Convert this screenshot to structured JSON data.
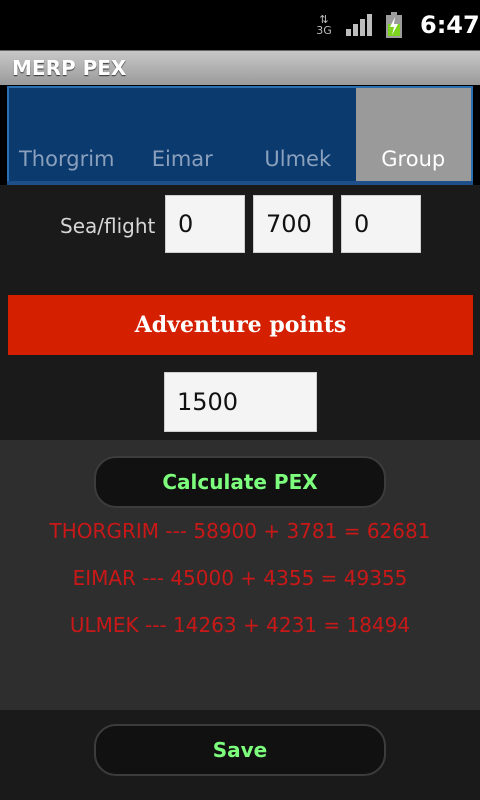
{
  "status_bar": {
    "data_icon": "3G data arrows icon",
    "network": "3G",
    "signal_icon": "signal-bars",
    "battery_icon": "battery-charging",
    "time": "6:47"
  },
  "app": {
    "title": "MERP PEX"
  },
  "tabs": [
    {
      "label": "Thorgrim",
      "selected": false
    },
    {
      "label": "Eimar",
      "selected": false
    },
    {
      "label": "Ulmek",
      "selected": false
    },
    {
      "label": "Group",
      "selected": true
    }
  ],
  "sea_flight": {
    "label": "Sea/flight",
    "values": [
      "0",
      "700",
      "0"
    ]
  },
  "adventure": {
    "header": "Adventure points",
    "value": "1500"
  },
  "calculate": {
    "label": "Calculate PEX"
  },
  "results": [
    "THORGRIM --- 58900 + 3781 = 62681",
    "EIMAR --- 45000 + 4355 = 49355",
    "ULMEK --- 14263 + 4231 = 18494"
  ],
  "save": {
    "label": "Save"
  },
  "colors": {
    "header_red": "#d42000",
    "result_red": "#c91818",
    "button_text_green": "#7dff7d",
    "tab_blue": "#0b3a6e",
    "tab_selected": "#9a9a9a"
  }
}
